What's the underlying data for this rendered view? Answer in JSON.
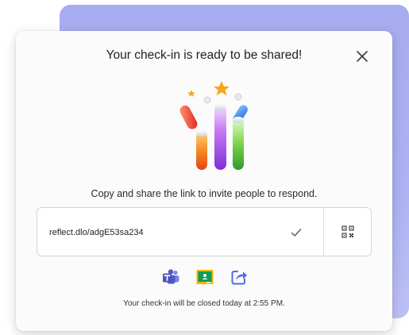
{
  "dialog": {
    "title": "Your check-in is ready to be shared!",
    "instruction": "Copy and share the link to invite people to respond.",
    "link": "reflect.dlo/adgE53sa234",
    "closing_note": "Your check-in will be closed today at 2:55 PM."
  },
  "icons": {
    "close": "close-icon",
    "copied": "checkmark-icon",
    "qr": "qr-code-icon",
    "share": [
      "teams-icon",
      "google-classroom-icon",
      "share-icon"
    ]
  },
  "colors": {
    "backdrop": "#a6acef",
    "teams": "#5059c9",
    "classroom_green": "#0f9d58",
    "classroom_yellow": "#f4b400",
    "share_blue": "#4f6bed"
  }
}
